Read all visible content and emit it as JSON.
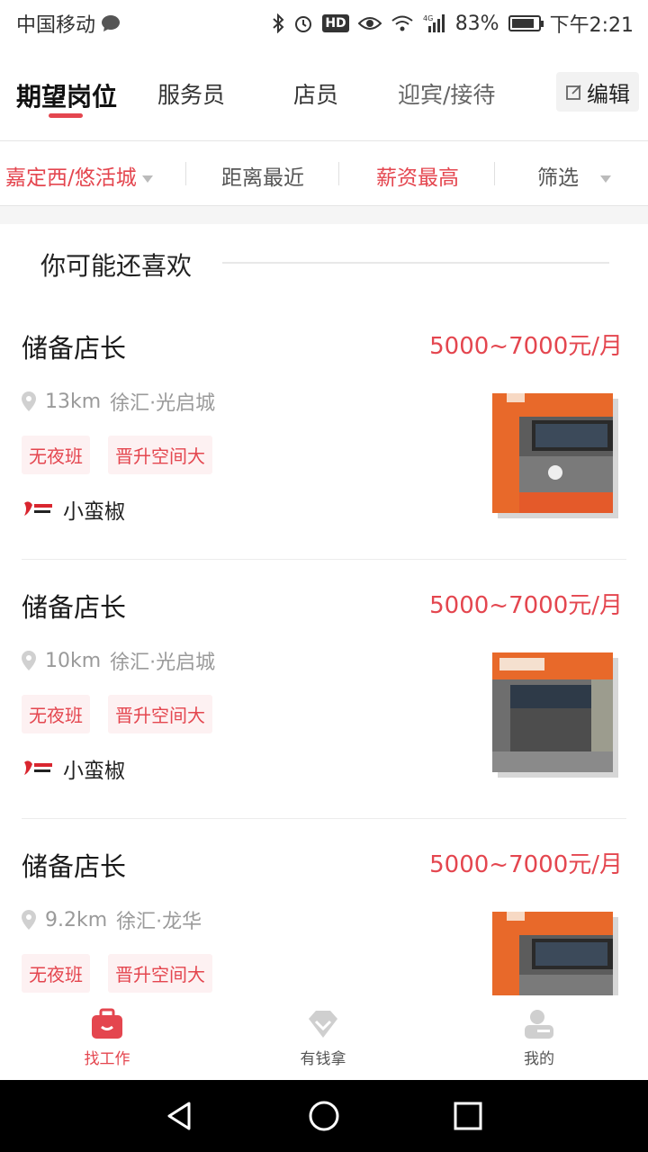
{
  "status_bar": {
    "carrier": "中国移动",
    "network_label": "4G",
    "battery": "83%",
    "hd_label": "HD",
    "time": "下午2:21"
  },
  "tabs": {
    "items": [
      "期望岗位",
      "服务员",
      "店员",
      "迎宾/接待"
    ],
    "active_index": 0,
    "edit_label": "编辑"
  },
  "filters": {
    "location": "嘉定西/悠活城",
    "nearest": "距离最近",
    "highest_salary": "薪资最高",
    "filter": "筛选"
  },
  "section": {
    "title": "你可能还喜欢"
  },
  "jobs": [
    {
      "title": "储备店长",
      "salary": "5000~7000元/月",
      "distance": "13km",
      "area": "徐汇·光启城",
      "tags": [
        "无夜班",
        "晋升空间大"
      ],
      "brand": "小蛮椒"
    },
    {
      "title": "储备店长",
      "salary": "5000~7000元/月",
      "distance": "10km",
      "area": "徐汇·光启城",
      "tags": [
        "无夜班",
        "晋升空间大"
      ],
      "brand": "小蛮椒"
    },
    {
      "title": "储备店长",
      "salary": "5000~7000元/月",
      "distance": "9.2km",
      "area": "徐汇·龙华",
      "tags": [
        "无夜班",
        "晋升空间大"
      ],
      "brand": ""
    }
  ],
  "bottom_nav": {
    "items": [
      {
        "label": "找工作",
        "icon": "briefcase-icon"
      },
      {
        "label": "有钱拿",
        "icon": "diamond-icon"
      },
      {
        "label": "我的",
        "icon": "profile-icon"
      }
    ],
    "active_index": 0
  },
  "colors": {
    "accent": "#e4464f",
    "text_primary": "#222222",
    "text_secondary": "#9a9a9a",
    "tag_bg": "#fdf1f2"
  }
}
